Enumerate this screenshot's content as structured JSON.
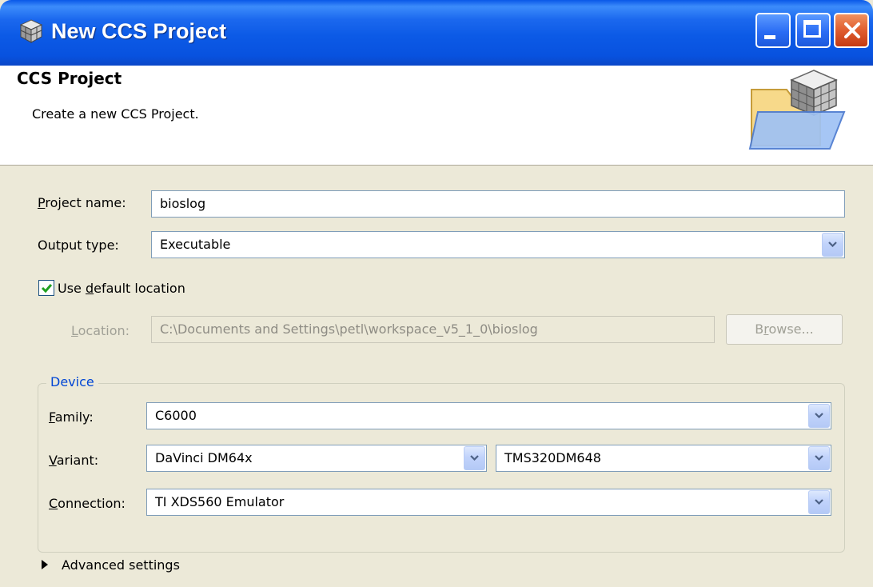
{
  "window": {
    "title": "New CCS Project",
    "title_icon": "cube-icon",
    "controls": [
      "minimize",
      "maximize",
      "close"
    ]
  },
  "header": {
    "title": "CCS Project",
    "description": "Create a new CCS Project.",
    "graphic": "folder-cube-icon"
  },
  "form": {
    "project_name": {
      "label_mnemonic": "P",
      "label_rest": "roject name:",
      "value": "bioslog"
    },
    "output_type": {
      "label": "Output type:",
      "value": "Executable"
    },
    "use_default_location": {
      "label_pre": "Use ",
      "label_mnemonic": "d",
      "label_post": "efault location",
      "checked": true
    },
    "location": {
      "label_mnemonic": "L",
      "label_rest": "ocation:",
      "value": "C:\\Documents and Settings\\petl\\workspace_v5_1_0\\bioslog",
      "enabled": false
    },
    "browse_button": {
      "label_pre": "B",
      "label_mnemonic": "r",
      "label_post": "owse...",
      "enabled": false
    }
  },
  "device": {
    "legend": "Device",
    "family": {
      "label_mnemonic": "F",
      "label_rest": "amily:",
      "value": "C6000"
    },
    "variant": {
      "label_mnemonic": "V",
      "label_rest": "ariant:",
      "value": "DaVinci DM64x",
      "value2": "TMS320DM648"
    },
    "connection": {
      "label_mnemonic": "C",
      "label_rest": "onnection:",
      "value": "TI XDS560 Emulator"
    }
  },
  "advanced": {
    "label": "Advanced settings",
    "expanded": false
  },
  "colors": {
    "titlebar": "#0c5ae6",
    "dialog_bg": "#ece9d8",
    "group_legend": "#0046d5",
    "field_border": "#7f9db9",
    "close_button": "#e05d2e"
  }
}
